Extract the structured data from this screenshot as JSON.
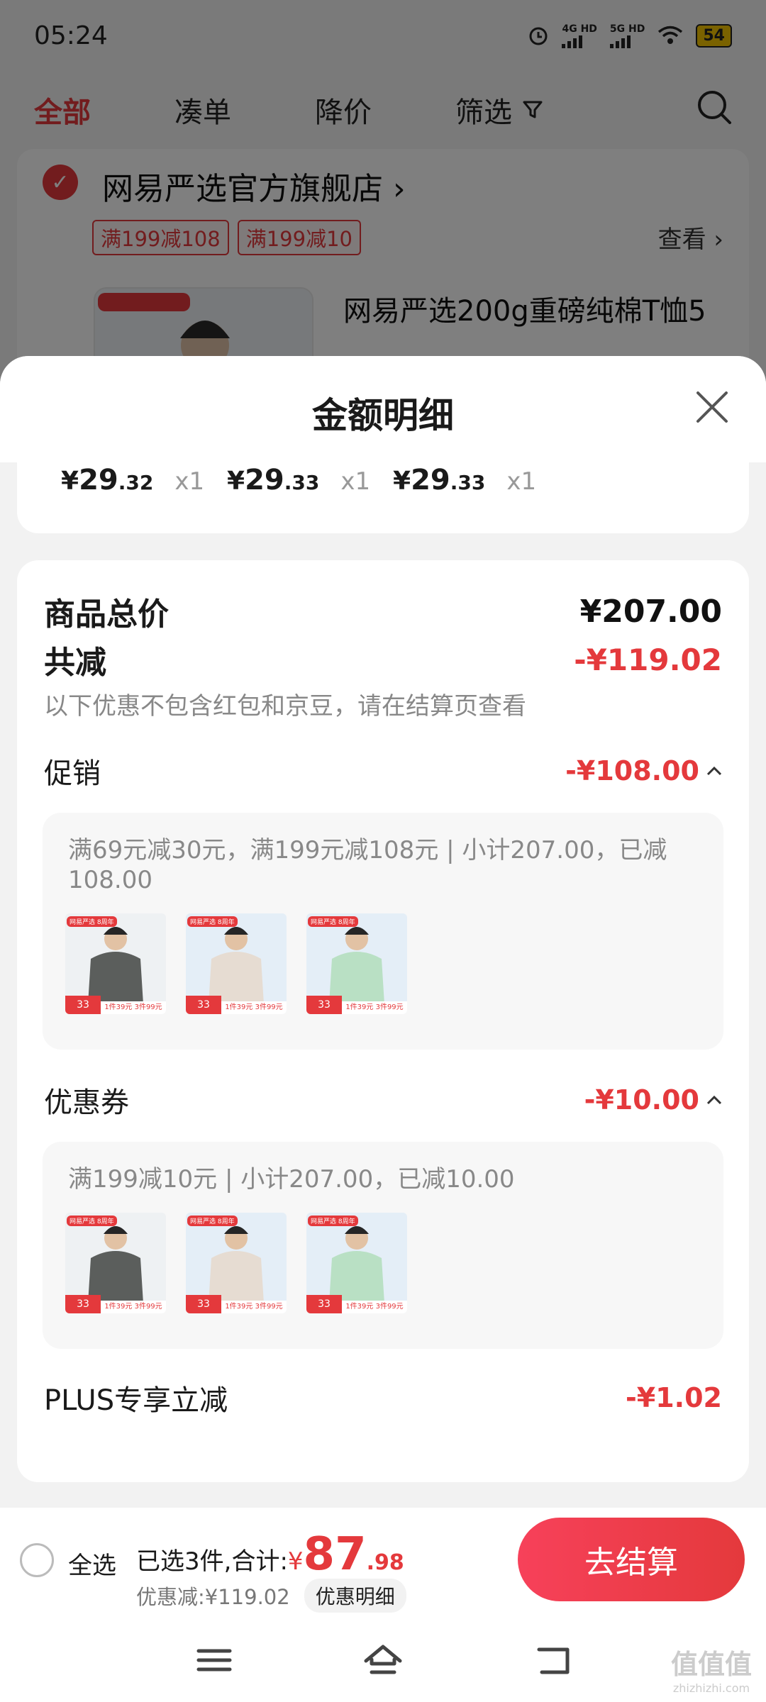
{
  "status_bar": {
    "time": "05:24",
    "net1": "4G HD",
    "net2": "5G HD",
    "battery": "54"
  },
  "tabs": [
    {
      "label": "全部",
      "active": true
    },
    {
      "label": "凑单",
      "active": false
    },
    {
      "label": "降价",
      "active": false
    },
    {
      "label": "筛选",
      "active": false
    }
  ],
  "store": {
    "name": "网易严选官方旗舰店",
    "chevron": "›",
    "tags": [
      "满199减108",
      "满199减10"
    ],
    "view_label": "查看 ›",
    "product_title": "网易严选200g重磅纯棉T恤5"
  },
  "sheet": {
    "title": "金额明细",
    "close_icon": "close-icon"
  },
  "units": [
    {
      "currency": "¥",
      "int": "29",
      "dec": ".32",
      "qty": "x1"
    },
    {
      "currency": "¥",
      "int": "29",
      "dec": ".33",
      "qty": "x1"
    },
    {
      "currency": "¥",
      "int": "29",
      "dec": ".33",
      "qty": "x1"
    }
  ],
  "summary": {
    "total_label": "商品总价",
    "total_value": "¥207.00",
    "reduce_label": "共减",
    "reduce_value": "-¥119.02",
    "reduce_note": "以下优惠不包含红包和京豆，请在结算页查看"
  },
  "promotion": {
    "label": "促销",
    "value": "-¥108.00",
    "desc": "满69元减30元，满199元减108元 | 小计207.00，已减108.00"
  },
  "coupon": {
    "label": "优惠券",
    "value": "-¥10.00",
    "desc": "满199减10元 | 小计207.00，已减10.00"
  },
  "plus": {
    "label": "PLUS专享立减",
    "value": "-¥1.02"
  },
  "thumb_items": [
    {
      "color": "#5b5e5c",
      "bg": "#eef1f3",
      "badge": "33",
      "strip": "1件39元 3件99元",
      "logo": "网易严选 8周年"
    },
    {
      "color": "#e6dcd2",
      "bg": "#e4eef7",
      "badge": "33",
      "strip": "1件39元 3件99元",
      "logo": "网易严选 8周年"
    },
    {
      "color": "#b9e0c4",
      "bg": "#e4eef7",
      "badge": "33",
      "strip": "1件39元 3件99元",
      "logo": "网易严选 8周年"
    }
  ],
  "cart": {
    "select_all": "全选",
    "selected_text": "已选3件,合计:",
    "yen": "¥",
    "amount_int": "87",
    "amount_dec": ".98",
    "saved_text": "优惠减:¥119.02",
    "detail_btn": "优惠明细",
    "checkout": "去结算"
  },
  "watermark": {
    "main": "值值值",
    "sub": "zhizhizhi.com"
  },
  "colors": {
    "accent": "#e4393c",
    "muted": "#888888"
  }
}
